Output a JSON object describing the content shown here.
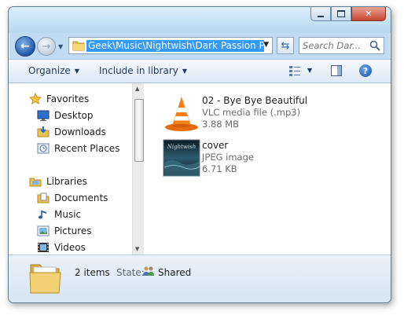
{
  "window": {
    "caption_buttons": {
      "minimize": "minimize-icon",
      "maximize": "maximize-icon",
      "close": "close-icon"
    }
  },
  "navbar": {
    "address_path": "Geek\\Music\\Nightwish\\Dark Passion Play",
    "search_placeholder": "Search Dar..."
  },
  "toolbar": {
    "organize": "Organize",
    "include": "Include in library"
  },
  "sidebar": {
    "items": [
      {
        "label": "Favorites",
        "icon": "star-icon"
      },
      {
        "label": "Desktop",
        "icon": "desktop-icon"
      },
      {
        "label": "Downloads",
        "icon": "downloads-icon"
      },
      {
        "label": "Recent Places",
        "icon": "recent-places-icon"
      },
      {
        "label": "Libraries",
        "icon": "libraries-icon"
      },
      {
        "label": "Documents",
        "icon": "documents-icon"
      },
      {
        "label": "Music",
        "icon": "music-icon"
      },
      {
        "label": "Pictures",
        "icon": "pictures-icon"
      },
      {
        "label": "Videos",
        "icon": "videos-icon"
      }
    ]
  },
  "files": [
    {
      "name": "02 - Bye Bye Beautiful",
      "type": "VLC media file (.mp3)",
      "size": "3.88 MB",
      "icon": "vlc-cone-icon"
    },
    {
      "name": "cover",
      "type": "JPEG image",
      "size": "6.71 KB",
      "icon": "album-cover-thumbnail",
      "thumb_text": "Nightwish"
    }
  ],
  "details": {
    "count": "2 items",
    "state_label": "State:",
    "state_value": "Shared"
  },
  "colors": {
    "selection": "#3399ff",
    "frame": "#bfdcf4"
  }
}
